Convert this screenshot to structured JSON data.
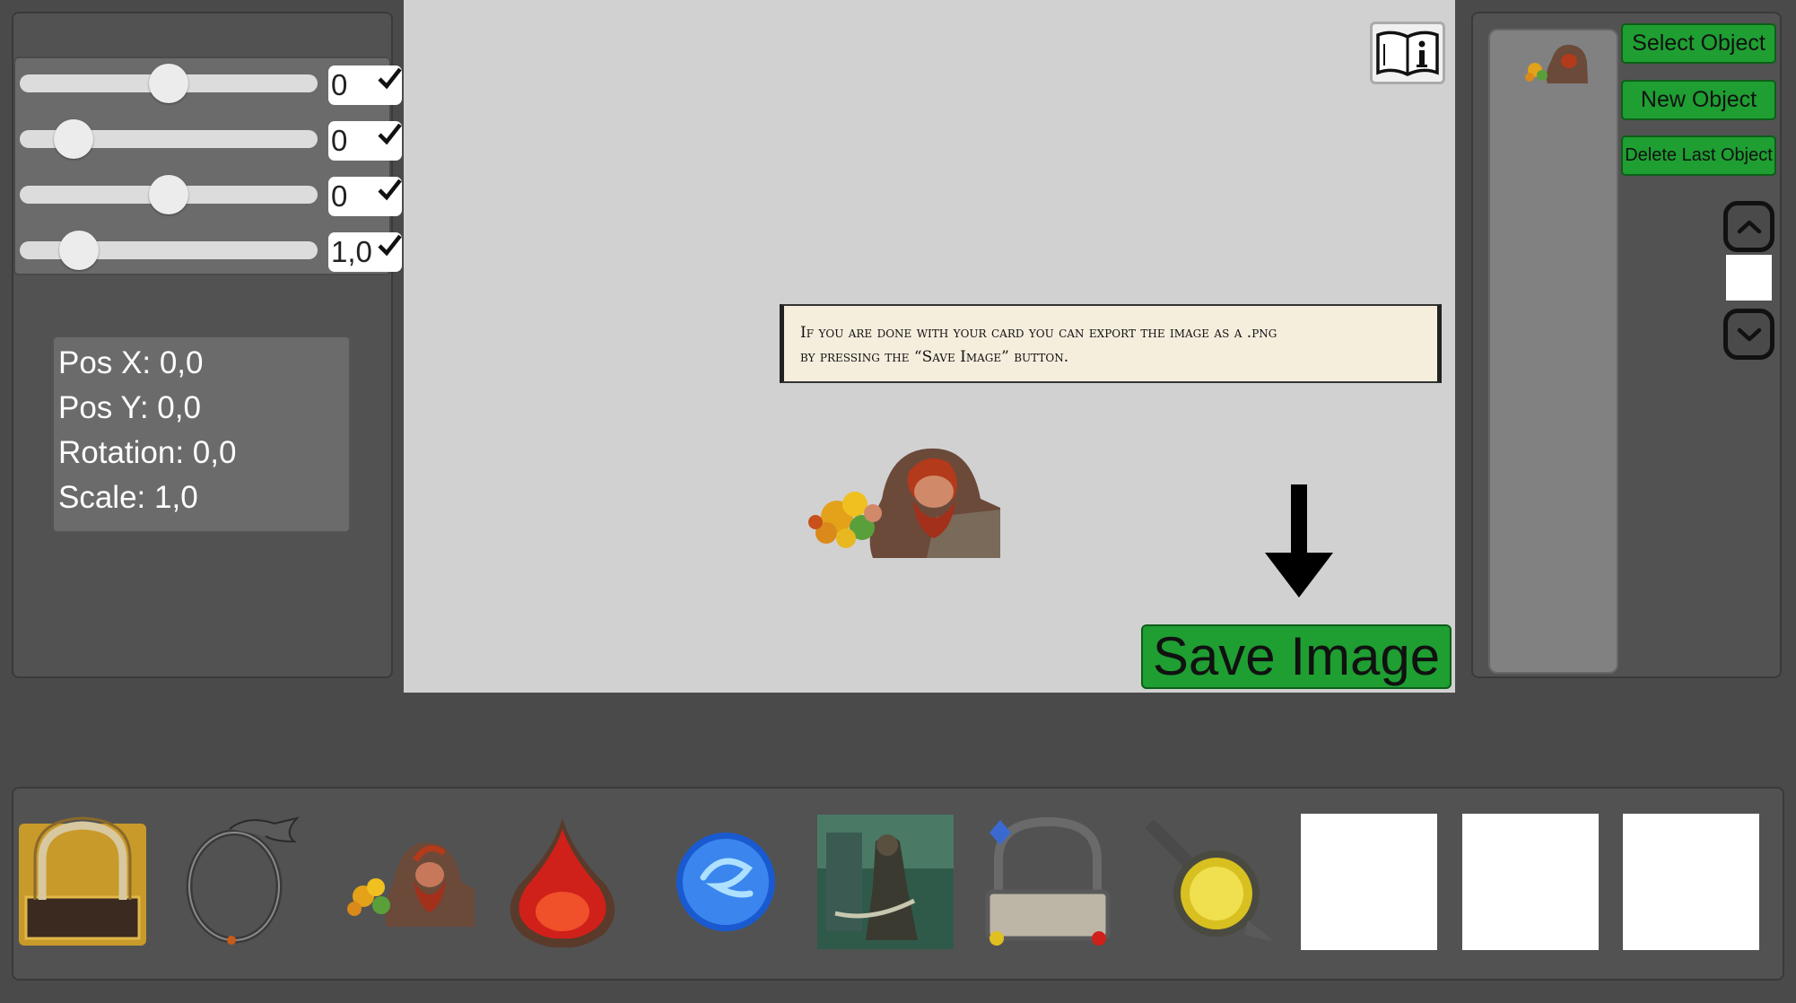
{
  "transform_sliders": [
    {
      "name": "x",
      "value_text": "0",
      "level": 0.5,
      "checked": true
    },
    {
      "name": "y",
      "value_text": "0",
      "level": 0.18,
      "checked": true
    },
    {
      "name": "rotation",
      "value_text": "0",
      "level": 0.5,
      "checked": true
    },
    {
      "name": "scale",
      "value_text": "1,0",
      "level": 0.2,
      "checked": true
    }
  ],
  "info": {
    "pos_x": "Pos X: 0,0",
    "pos_y": "Pos Y: 0,0",
    "rotation": "Rotation: 0,0",
    "scale": "Scale: 1,0"
  },
  "tooltip": {
    "line1": "If you are done with your card you can export the image as a .png",
    "line2": "by pressing the “Save Image” button."
  },
  "save_button": "Save Image",
  "right_panel": {
    "select_object": "Select Object",
    "new_object": "New Object",
    "delete_last_object": "Delete Last Object"
  },
  "icons": {
    "help": "book-info-icon",
    "arrow": "arrow-down-icon",
    "up": "chevron-up-icon",
    "down": "chevron-down-icon"
  },
  "asset_bar": [
    {
      "name": "gold-frame"
    },
    {
      "name": "dragon-ring"
    },
    {
      "name": "dwarf-portrait"
    },
    {
      "name": "red-gem"
    },
    {
      "name": "blue-orb"
    },
    {
      "name": "warrior-art"
    },
    {
      "name": "card-frame"
    },
    {
      "name": "yellow-gem-sword"
    },
    {
      "name": "blank"
    },
    {
      "name": "blank"
    },
    {
      "name": "blank"
    }
  ],
  "colors": {
    "panel": "#525252",
    "canvas": "#d1d1d1",
    "green_button": "#1f9e32",
    "tooltip_bg": "#f6eedd"
  }
}
